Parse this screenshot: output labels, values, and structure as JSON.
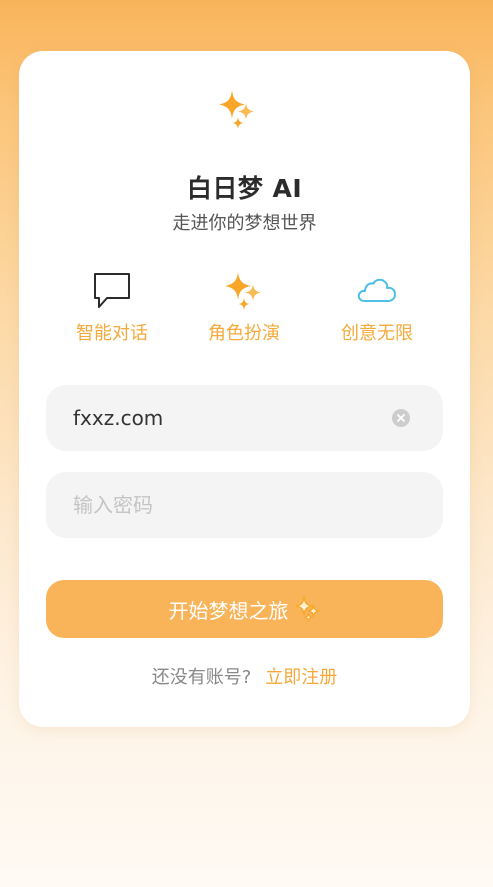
{
  "header": {
    "logo_icon": "sparkles-icon",
    "title": "白日梦 AI",
    "subtitle": "走进你的梦想世界"
  },
  "features": [
    {
      "icon": "chat-bubble-icon",
      "label": "智能对话"
    },
    {
      "icon": "sparkles-icon",
      "label": "角色扮演"
    },
    {
      "icon": "cloud-icon",
      "label": "创意无限"
    }
  ],
  "form": {
    "email": {
      "value": "fxxz.com",
      "clear_icon": "clear-icon"
    },
    "password": {
      "placeholder": "输入密码",
      "value": ""
    }
  },
  "start_button": {
    "label": "开始梦想之旅",
    "icon": "sparkles-icon"
  },
  "footer": {
    "question": "还没有账号?",
    "register_link": "立即注册"
  },
  "colors": {
    "accent": "#F9B45A",
    "accent_text": "#F5A93A",
    "cloud": "#4CC0E6",
    "input_bg": "#F4F4F4"
  }
}
